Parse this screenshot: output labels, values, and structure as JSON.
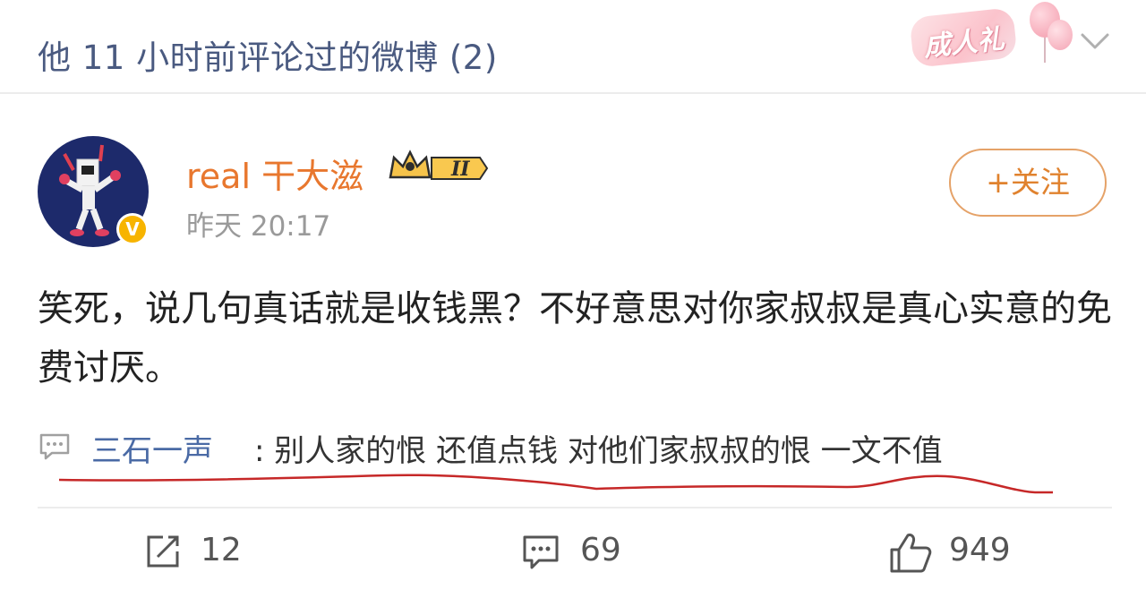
{
  "header": {
    "title": "他 11 小时前评论过的微博 (2)",
    "badge_text": "成人礼",
    "expand_icon": "chevron-down-icon"
  },
  "post": {
    "author": {
      "name": "real 干大滋",
      "level_badge": "II",
      "verified_badge": "V"
    },
    "time": "昨天 20:17",
    "follow_label": "+关注",
    "text": "笑死，说几句真话就是收钱黑？不好意思对你家叔叔是真心实意的免费讨厌。",
    "comment": {
      "author": "三石一声",
      "text": ": 别人家的恨 还值点钱 对他们家叔叔的恨 一文不值"
    },
    "actions": {
      "repost_count": "12",
      "comment_count": "69",
      "like_count": "949"
    }
  },
  "colors": {
    "accent_orange": "#e8772e",
    "link_blue": "#4a6aa5",
    "header_text": "#4a5a80",
    "underline_red": "#c62828"
  }
}
